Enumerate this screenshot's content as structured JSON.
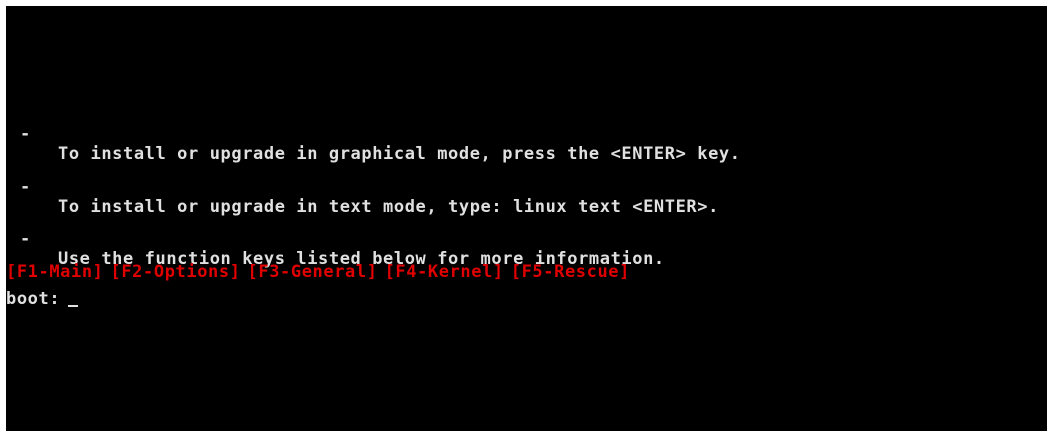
{
  "instructions": [
    {
      "bullet": "-",
      "text": "To install or upgrade in graphical mode, press the <ENTER> key."
    },
    {
      "bullet": "-",
      "text": "To install or upgrade in text mode, type: linux text <ENTER>."
    },
    {
      "bullet": "-",
      "text": "Use the function keys listed below for more information."
    }
  ],
  "function_keys": [
    "[F1-Main]",
    "[F2-Options]",
    "[F3-General]",
    "[F4-Kernel]",
    "[F5-Rescue]"
  ],
  "prompt": {
    "label": "boot:",
    "value": ""
  },
  "colors": {
    "background": "#000000",
    "text": "#e0e0e0",
    "function_keys": "#e00000"
  }
}
